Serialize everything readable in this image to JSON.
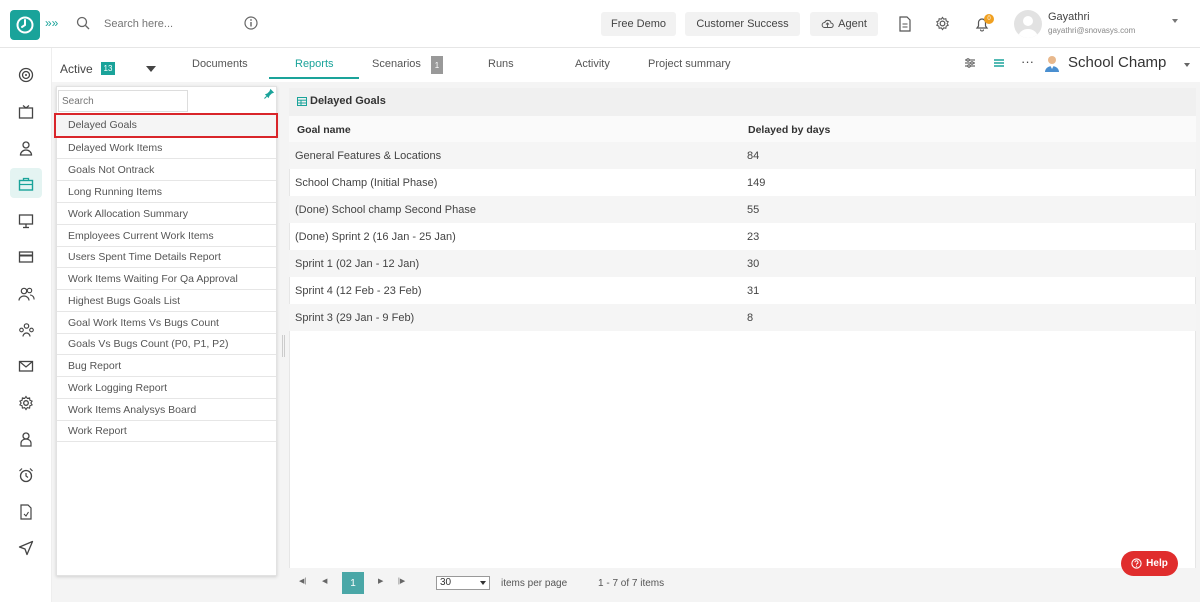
{
  "topbar": {
    "search_placeholder": "Search here...",
    "free_demo": "Free Demo",
    "customer_success": "Customer Success",
    "agent": "Agent",
    "notification_count": "0",
    "user_name": "Gayathri",
    "user_email": "gayathri@snovasys.com"
  },
  "tabs_bar": {
    "active_label": "Active",
    "active_count": "13",
    "tabs": [
      "Documents",
      "Reports",
      "Scenarios",
      "Runs",
      "Activity",
      "Project summary"
    ],
    "selected_tab": "Reports",
    "scenarios_count": "1",
    "project_name": "School Champ"
  },
  "report_list": {
    "search_placeholder": "Search",
    "selected": "Delayed Goals",
    "items": [
      "Delayed Goals",
      "Delayed Work Items",
      "Goals Not Ontrack",
      "Long Running Items",
      "Work Allocation Summary",
      "Employees Current Work Items",
      "Users Spent Time Details Report",
      "Work Items Waiting For Qa Approval",
      "Highest Bugs Goals List",
      "Goal Work Items Vs Bugs Count",
      "Goals Vs Bugs Count (P0, P1, P2)",
      "Bug Report",
      "Work Logging Report",
      "Work Items Analysys Board",
      "Work Report"
    ]
  },
  "report_table": {
    "title": "Delayed Goals",
    "columns": [
      "Goal name",
      "Delayed by days"
    ],
    "rows": [
      [
        "General Features & Locations",
        "84"
      ],
      [
        "School Champ (Initial Phase)",
        "149"
      ],
      [
        "(Done) School champ Second Phase",
        "55"
      ],
      [
        "(Done) Sprint 2 (16 Jan - 25 Jan)",
        "23"
      ],
      [
        "Sprint 1 (02 Jan - 12 Jan)",
        "30"
      ],
      [
        "Sprint 4 (12 Feb - 23 Feb)",
        "31"
      ],
      [
        "Sprint 3 (29 Jan - 9 Feb)",
        "8"
      ]
    ]
  },
  "pager": {
    "current_page": "1",
    "page_size": "30",
    "items_per_page_label": "items per page",
    "range_text": "1 - 7 of 7 items"
  },
  "help_label": "Help",
  "colors": {
    "accent": "#1aa39a",
    "selection_border": "#d9252a",
    "help": "#e02d2d",
    "pager_active": "#4aa7a7"
  },
  "icons": {
    "nav": [
      "target-icon",
      "tv-icon",
      "user-icon",
      "briefcase-icon",
      "monitor-icon",
      "card-icon",
      "users-icon",
      "team-icon",
      "mail-icon",
      "settings-icon",
      "badge-icon",
      "alarm-icon",
      "document-icon",
      "send-icon"
    ]
  }
}
